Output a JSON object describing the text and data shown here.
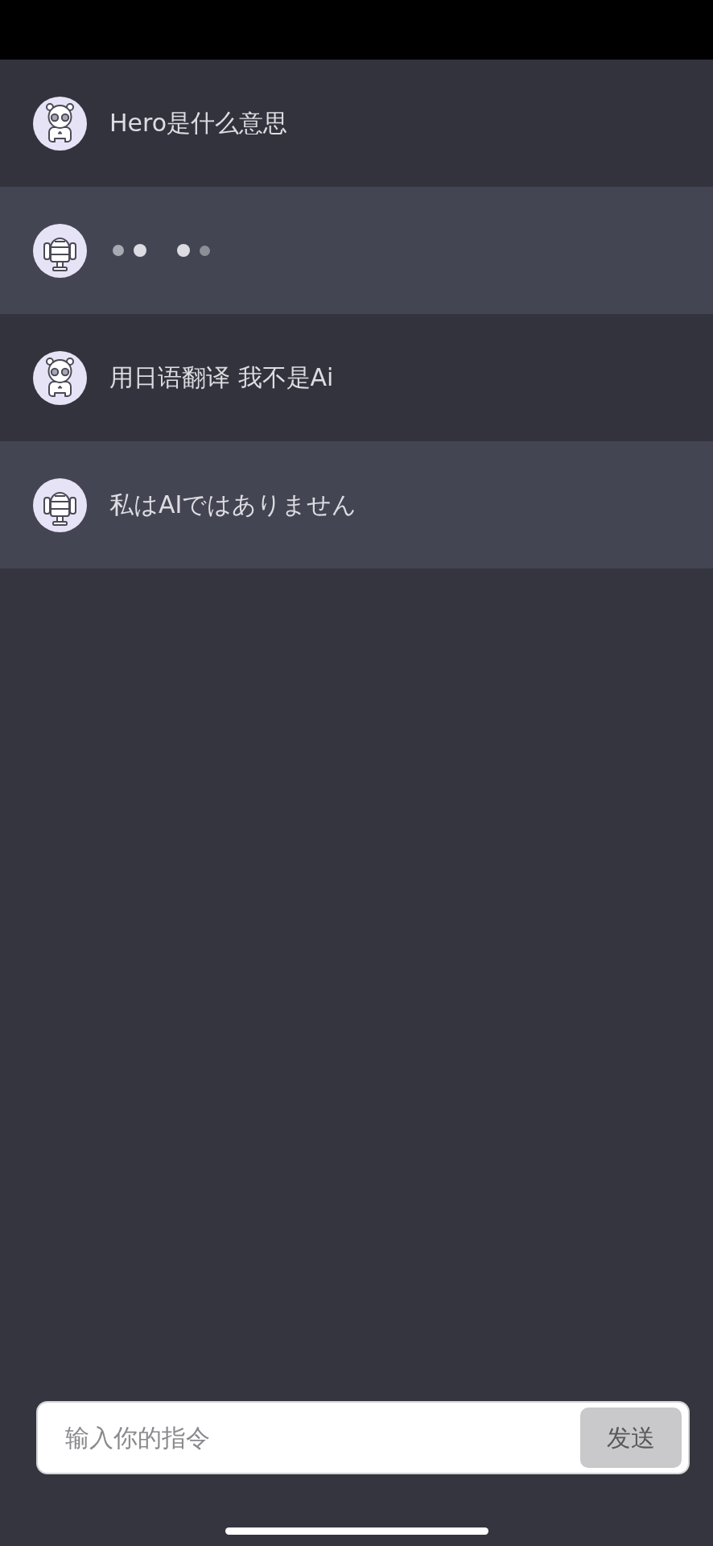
{
  "messages": [
    {
      "kind": "question",
      "text": "Hero是什么意思"
    },
    {
      "kind": "typing"
    },
    {
      "kind": "question",
      "text": "用日语翻译 我不是Ai"
    },
    {
      "kind": "answer",
      "text": "私はAIではありません"
    }
  ],
  "composer": {
    "placeholder": "输入你的指令",
    "send_button": "发送"
  }
}
